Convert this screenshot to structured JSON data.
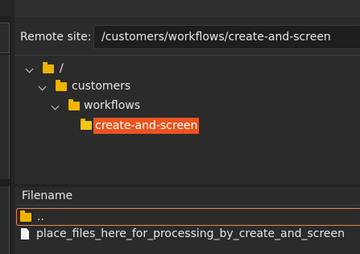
{
  "remote_site": {
    "label": "Remote site:",
    "path": "/customers/workflows/create-and-screen"
  },
  "tree": {
    "items": [
      {
        "label": "/",
        "icon": "folder-icon",
        "expanded": true
      },
      {
        "label": "customers",
        "icon": "folder-icon",
        "expanded": true
      },
      {
        "label": "workflows",
        "icon": "folder-icon",
        "expanded": true
      },
      {
        "label": "create-and-screen",
        "icon": "folder-open-icon",
        "selected": true
      }
    ]
  },
  "file_list": {
    "header": "Filename",
    "rows": [
      {
        "name": "..",
        "icon": "folder-icon",
        "focused": true
      },
      {
        "name": "place_files_here_for_processing_by_create_and_screen",
        "icon": "file-icon"
      }
    ]
  },
  "colors": {
    "selection": "#e95420",
    "folder": "#f0b400",
    "focus_border": "#e08a5a"
  }
}
